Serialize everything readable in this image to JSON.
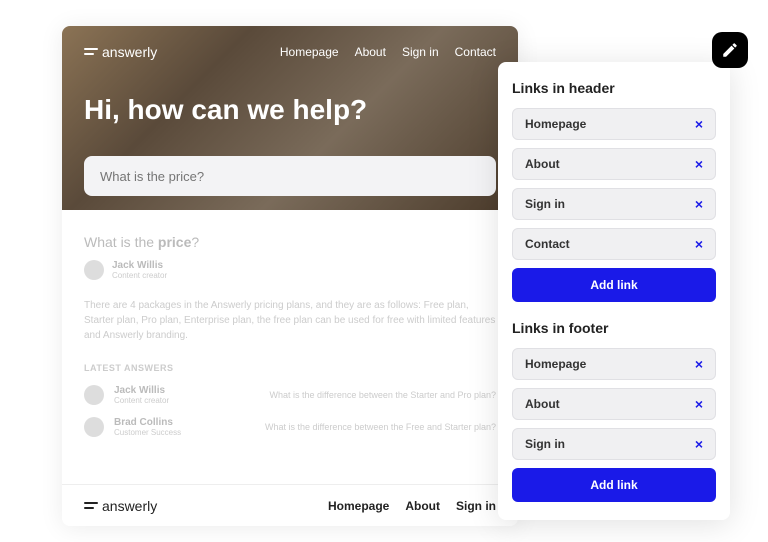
{
  "brand": "answerly",
  "nav": {
    "homepage": "Homepage",
    "about": "About",
    "signin": "Sign in",
    "contact": "Contact"
  },
  "hero": {
    "title": "Hi, how can we help?",
    "search_placeholder": "What is the price?"
  },
  "question": {
    "prefix": "What is the ",
    "bold": "price",
    "suffix": "?"
  },
  "author1": {
    "name": "Jack Willis",
    "role": "Content creator"
  },
  "answer_text": "There are 4 packages in the Answerly pricing plans, and they are as follows: Free plan, Starter plan, Pro plan, Enterprise plan, the free plan can be used for free with limited features and Answerly branding.",
  "latest_label": "LATEST ANSWERS",
  "latest": [
    {
      "name": "Jack Willis",
      "role": "Content creator",
      "q": "What is the difference between the Starter and Pro plan?"
    },
    {
      "name": "Brad Collins",
      "role": "Customer Success",
      "q": "What is the difference between the Free and Starter plan?"
    }
  ],
  "footer_nav": {
    "homepage": "Homepage",
    "about": "About",
    "signin": "Sign in"
  },
  "panel": {
    "header_title": "Links in header",
    "footer_title": "Links in footer",
    "add_label": "Add link",
    "header_links": [
      "Homepage",
      "About",
      "Sign in",
      "Contact"
    ],
    "footer_links": [
      "Homepage",
      "About",
      "Sign in"
    ]
  }
}
